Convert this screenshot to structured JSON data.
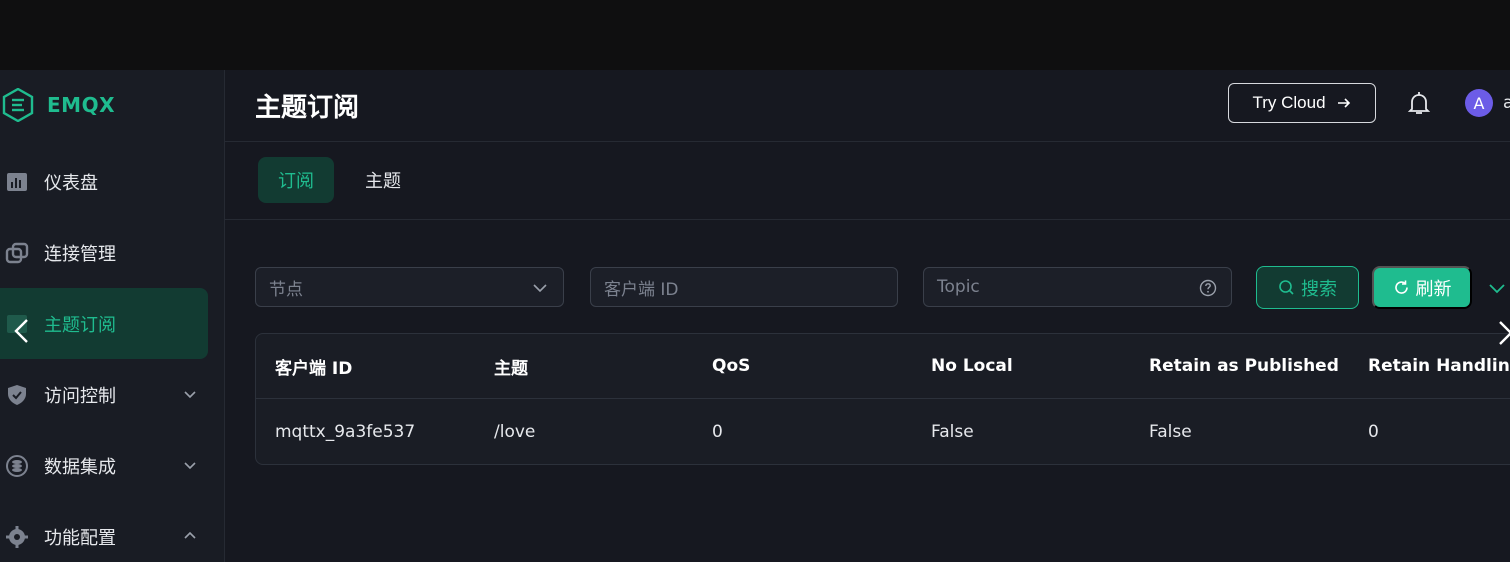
{
  "app": {
    "logo_text": "EMQX",
    "brand_color": "#1fbc8f"
  },
  "sidebar": {
    "items": [
      {
        "label": "仪表盘",
        "icon": "dashboard-icon",
        "expandable": false
      },
      {
        "label": "连接管理",
        "icon": "connections-icon",
        "expandable": false
      },
      {
        "label": "主题订阅",
        "icon": "topic-subscription-icon",
        "expandable": false,
        "active": true
      },
      {
        "label": "访问控制",
        "icon": "shield-icon",
        "expandable": true,
        "expanded": false
      },
      {
        "label": "数据集成",
        "icon": "data-integration-icon",
        "expandable": true,
        "expanded": false
      },
      {
        "label": "功能配置",
        "icon": "gear-icon",
        "expandable": true,
        "expanded": true
      }
    ]
  },
  "header": {
    "title": "主题订阅",
    "try_cloud_label": "Try Cloud",
    "avatar_letter": "A",
    "username": "a"
  },
  "tabs": [
    {
      "label": "订阅",
      "active": true
    },
    {
      "label": "主题",
      "active": false
    }
  ],
  "filters": {
    "node_placeholder": "节点",
    "client_id_placeholder": "客户端 ID",
    "topic_placeholder": "Topic",
    "search_label": "搜索",
    "refresh_label": "刷新"
  },
  "table": {
    "columns": [
      "客户端 ID",
      "主题",
      "QoS",
      "No Local",
      "Retain as Published",
      "Retain Handling"
    ],
    "rows": [
      [
        "mqttx_9a3fe537",
        "/love",
        "0",
        "False",
        "False",
        "0"
      ]
    ]
  }
}
